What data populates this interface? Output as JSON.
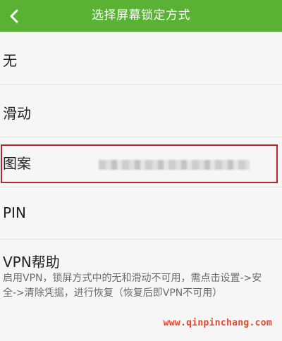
{
  "header": {
    "title": "选择屏幕锁定方式",
    "back_icon": "chevron-left-icon"
  },
  "options": [
    {
      "label": "无"
    },
    {
      "label": "滑动"
    },
    {
      "label": "图案",
      "selected": true
    },
    {
      "label": "PIN"
    },
    {
      "label": "VPN帮助",
      "description": "启用VPN，锁屏方式中的无和滑动不可用，需点击设置->安全->清除凭据，进行恢复（恢复后即VPN不可用）"
    }
  ],
  "watermark": "www.qinpinchang.com",
  "colors": {
    "header_bg": "#59b234",
    "highlight": "#b8262d",
    "watermark": "#e8452a"
  }
}
